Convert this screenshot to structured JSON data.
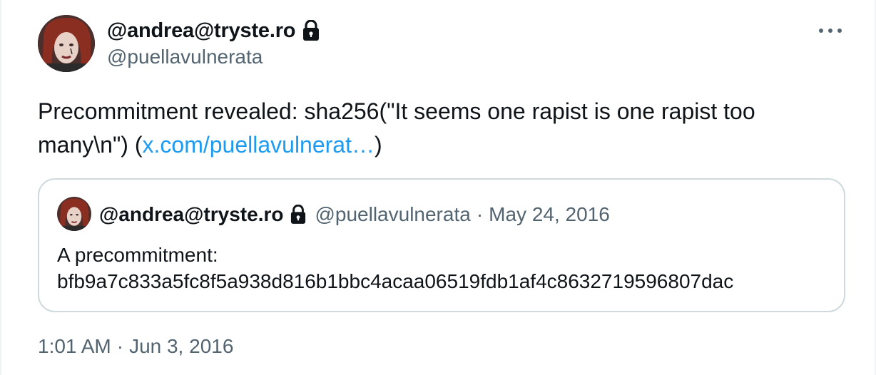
{
  "author": {
    "display_name": "@andrea@tryste.ro",
    "handle": "@puellavulnerata",
    "protected_icon": "lock-icon"
  },
  "tweet": {
    "text_before": "Precommitment revealed: sha256(\"It seems one rapist is one rapist too many\\n\") (",
    "link_text": "x.com/puellavulnerat…",
    "text_after": ")",
    "time": "1:01 AM",
    "separator": "·",
    "date": "Jun 3, 2016"
  },
  "quoted": {
    "display_name": "@andrea@tryste.ro",
    "handle": "@puellavulnerata",
    "separator": "·",
    "date": "May 24, 2016",
    "line1": "A precommitment:",
    "line2": "bfb9a7c833a5fc8f5a938d816b1bbc4acaa06519fdb1af4c8632719596807dac"
  },
  "menu": {
    "icon": "more-horizontal-icon"
  },
  "colors": {
    "text": "#0f1419",
    "secondary": "#536471",
    "link": "#1d9bf0",
    "border": "#cfd9de"
  }
}
